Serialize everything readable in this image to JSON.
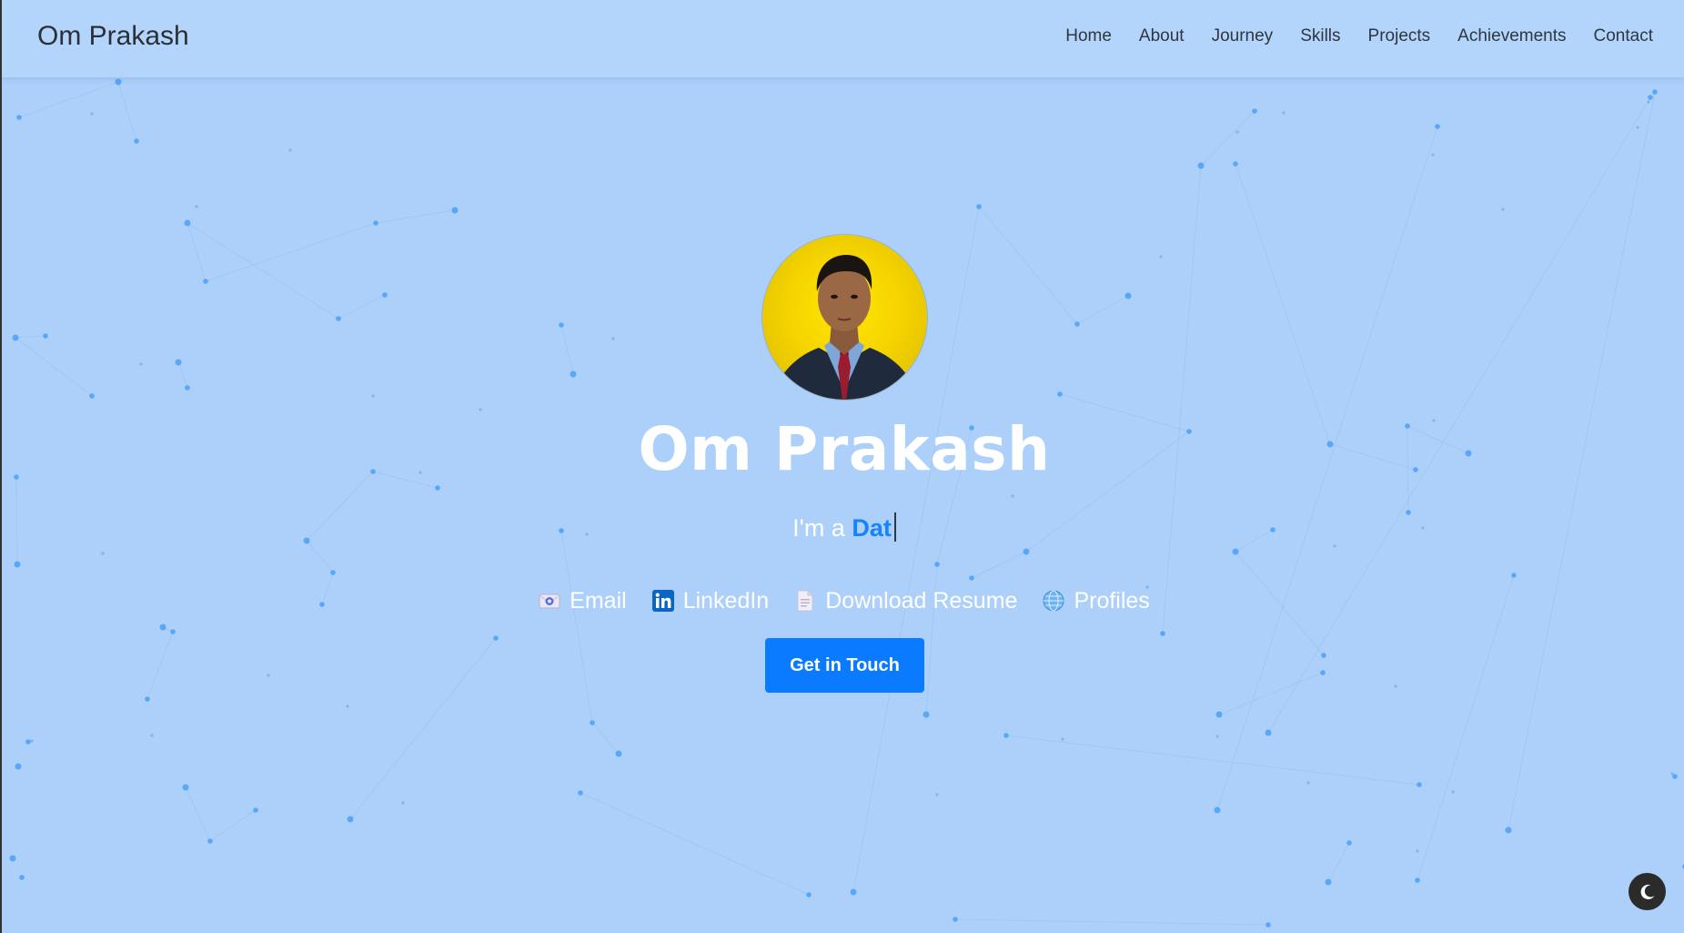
{
  "header": {
    "brand": "Om Prakash",
    "nav": [
      "Home",
      "About",
      "Journey",
      "Skills",
      "Projects",
      "Achievements",
      "Contact"
    ]
  },
  "hero": {
    "name": "Om Prakash",
    "tagline_prefix": "I'm a ",
    "tagline_typed": "Dat",
    "links": [
      {
        "label": "Email",
        "icon": "email-icon"
      },
      {
        "label": "LinkedIn",
        "icon": "linkedin-icon"
      },
      {
        "label": "Download Resume",
        "icon": "document-icon"
      },
      {
        "label": "Profiles",
        "icon": "globe-icon"
      }
    ],
    "cta_label": "Get in Touch"
  },
  "colors": {
    "background": "#acd0fa",
    "accent": "#0a7bff",
    "typed_text": "#1683ff"
  },
  "theme_toggle": {
    "icon": "moon-icon"
  }
}
